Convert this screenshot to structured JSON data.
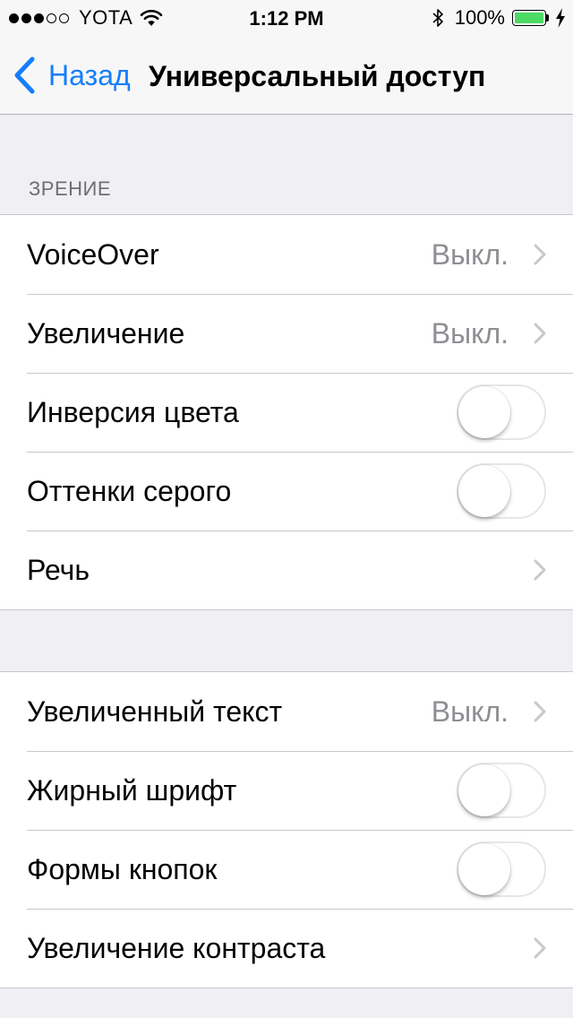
{
  "status_bar": {
    "carrier": "YOTA",
    "time": "1:12 PM",
    "battery": "100%",
    "signal_bars_filled": 3,
    "signal_bars_total": 5,
    "battery_level": 1.0
  },
  "nav": {
    "back_label": "Назад",
    "title": "Универсальный доступ"
  },
  "sections": {
    "vision_header": "ЗРЕНИЕ"
  },
  "group1": [
    {
      "label": "VoiceOver",
      "value": "Выкл.",
      "type": "disclosure"
    },
    {
      "label": "Увеличение",
      "value": "Выкл.",
      "type": "disclosure"
    },
    {
      "label": "Инверсия цвета",
      "type": "toggle",
      "on": false
    },
    {
      "label": "Оттенки серого",
      "type": "toggle",
      "on": false
    },
    {
      "label": "Речь",
      "type": "disclosure"
    }
  ],
  "group2": [
    {
      "label": "Увеличенный текст",
      "value": "Выкл.",
      "type": "disclosure"
    },
    {
      "label": "Жирный шрифт",
      "type": "toggle",
      "on": false
    },
    {
      "label": "Формы кнопок",
      "type": "toggle",
      "on": false
    },
    {
      "label": "Увеличение контраста",
      "type": "disclosure"
    }
  ],
  "colors": {
    "accent": "#157efb",
    "battery_fill": "#4cd964",
    "secondary_text": "#8e8e93",
    "section_text": "#6d6d72",
    "background": "#efeff4"
  },
  "icons": {
    "back": "chevron-left-icon",
    "disclosure": "chevron-right-icon",
    "wifi": "wifi-icon",
    "bluetooth": "bluetooth-icon",
    "battery": "battery-icon",
    "charging": "charging-bolt-icon"
  }
}
